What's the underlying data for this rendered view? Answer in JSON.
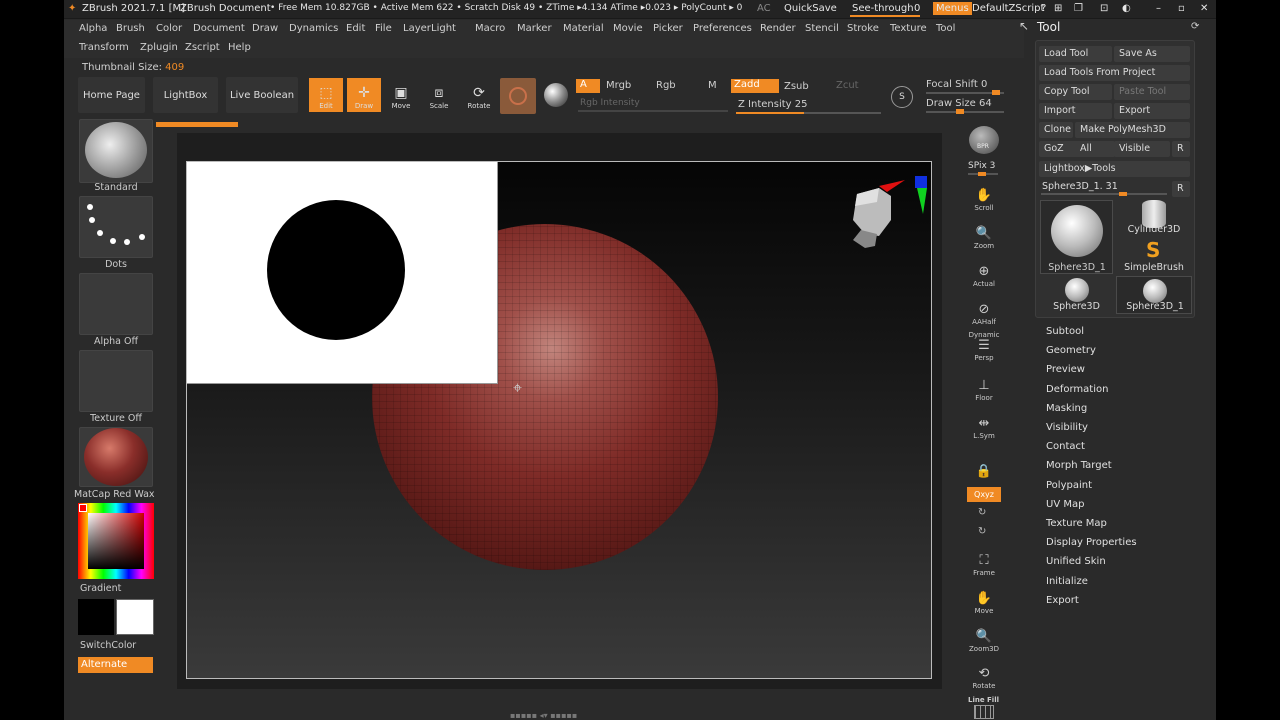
{
  "title_bar": {
    "app": "ZBrush 2021.7.1 [M]",
    "document": "ZBrush Document",
    "stats": "• Free Mem 10.827GB • Active Mem 622 • Scratch Disk 49 • ZTime ▸4.134 ATime ▸0.023 ▸ PolyCount ▸ 0",
    "ac": "AC",
    "quicksave": "QuickSave",
    "see_through_label": "See-through",
    "see_through_value": "0",
    "menus": "Menus",
    "zscript": "DefaultZScript"
  },
  "menu_row1": [
    "Alpha",
    "Brush",
    "Color",
    "Document",
    "Draw",
    "Dynamics",
    "Edit",
    "File",
    "Layer",
    "Light",
    "Macro",
    "Marker",
    "Material",
    "Movie",
    "Picker",
    "Preferences",
    "Render",
    "Stencil",
    "Stroke",
    "Texture",
    "Tool"
  ],
  "menu_row2": [
    "Transform",
    "Zplugin",
    "Zscript",
    "Help"
  ],
  "thumbnail": {
    "label": "Thumbnail Size:",
    "value": "409"
  },
  "shelf": {
    "home_page": "Home Page",
    "lightbox": "LightBox",
    "live_boolean": "Live Boolean",
    "edit": "Edit",
    "draw": "Draw",
    "move": "Move",
    "scale": "Scale",
    "rotate": "Rotate",
    "a": "A",
    "mrgb": "Mrgb",
    "rgb": "Rgb",
    "m": "M",
    "zadd": "Zadd",
    "zsub": "Zsub",
    "zcut": "Zcut",
    "rgb_intensity": "Rgb Intensity",
    "z_intensity": "Z Intensity 25",
    "focal_shift": "Focal Shift 0",
    "draw_size": "Draw Size 64"
  },
  "left_tray": {
    "standard": "Standard",
    "dots": "Dots",
    "alpha_off": "Alpha Off",
    "texture_off": "Texture Off",
    "matcap": "MatCap Red Wax",
    "gradient": "Gradient",
    "switch_color": "SwitchColor",
    "alternate": "Alternate"
  },
  "right_tray": {
    "bpr": "BPR",
    "spix": "SPix 3",
    "scroll": "Scroll",
    "zoom": "Zoom",
    "actual": "Actual",
    "aahalf": "AAHalf",
    "dynamic": "Dynamic",
    "persp": "Persp",
    "floor": "Floor",
    "lsym": "L.Sym",
    "xyz": "Qxyz",
    "frame": "Frame",
    "move": "Move",
    "zoom3d": "Zoom3D",
    "rotate": "Rotate",
    "linefill": "Line Fill"
  },
  "tool_panel": {
    "header": "Tool",
    "load_tool": "Load Tool",
    "save_as": "Save As",
    "load_from_project": "Load Tools From Project",
    "copy_tool": "Copy Tool",
    "paste_tool": "Paste Tool",
    "import": "Import",
    "export": "Export",
    "clone": "Clone",
    "make_polymesh": "Make PolyMesh3D",
    "goz": "GoZ",
    "all": "All",
    "visible": "Visible",
    "r": "R",
    "lightbox_tools": "Lightbox▶Tools",
    "current_tool": "Sphere3D_1. 31",
    "thumbs": [
      "Sphere3D_1",
      "Cylinder3D",
      "SimpleBrush",
      "Sphere3D",
      "Sphere3D_1"
    ]
  },
  "subpalettes": [
    "Subtool",
    "Geometry",
    "Preview",
    "Deformation",
    "Masking",
    "Visibility",
    "Contact",
    "Morph Target",
    "Polypaint",
    "UV Map",
    "Texture Map",
    "Display Properties",
    "Unified Skin",
    "Initialize",
    "Export"
  ],
  "colors": {
    "accent": "#f08a24",
    "sphere": "#8a2e2a"
  }
}
